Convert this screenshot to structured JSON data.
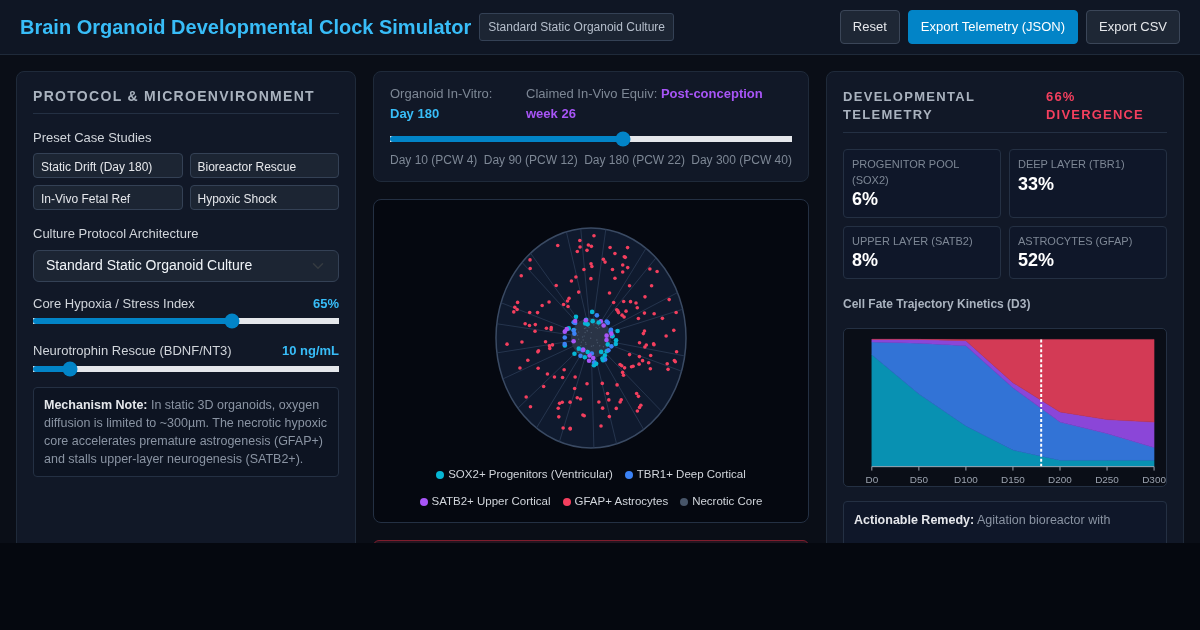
{
  "header": {
    "title": "Brain Organoid Developmental Clock Simulator",
    "badge": "Standard Static Organoid Culture",
    "buttons": [
      {
        "label": "Reset",
        "kind": "plain"
      },
      {
        "label": "Export Telemetry (JSON)",
        "kind": "primary"
      },
      {
        "label": "Export CSV",
        "kind": "plain"
      }
    ]
  },
  "protocol_panel": {
    "title": "PROTOCOL & MICROENVIRONMENT",
    "presets_label": "Preset Case Studies",
    "presets": [
      "Static Drift (Day 180)",
      "Bioreactor Rescue",
      "In-Vivo Fetal Ref",
      "Hypoxic Shock"
    ],
    "architecture_label": "Culture Protocol Architecture",
    "architecture": {
      "value": "Standard Static Organoid Culture"
    },
    "sliders": [
      {
        "label": "Core Hypoxia / Stress Index",
        "reading": "65%",
        "level": 0.65
      },
      {
        "label": "Neurotrophin Rescue (BDNF/NT3)",
        "reading": "10 ng/mL",
        "level": 0.12
      }
    ],
    "note": "**Mechanism Note:** In static 3D organoids, oxygen diffusion is limited to ~300µm. The necrotic hypoxic core accelerates premature astrogenesis (GFAP+) and stalls upper-layer neurogenesis (SATB2+)."
  },
  "timeline": {
    "invitro_label": "Organoid In-Vitro:",
    "invitro_value": "Day 180",
    "invivo_label": "Claimed In-Vivo Equiv:",
    "invivo_value": "Post-conception week 26",
    "level": 0.58,
    "ticks": [
      "Day 10 (PCW 4)",
      "Day 90 (PCW 12)",
      "Day 180 (PCW 22)",
      "Day 300 (PCW 40)"
    ]
  },
  "organoid": {
    "legend": [
      {
        "label": "SOX2+ Progenitors (Ventricular)",
        "color": "#06b6d4"
      },
      {
        "label": "TBR1+ Deep Cortical",
        "color": "#3b82f6"
      },
      {
        "label": "SATB2+ Upper Cortical",
        "color": "#a855f7"
      },
      {
        "label": "GFAP+ Astrocytes",
        "color": "#f43f5e"
      },
      {
        "label": "Necrotic Core",
        "color": "#475569"
      }
    ]
  },
  "alert": {
    "kind": "danger"
  },
  "telemetry": {
    "title": "DEVELOPMENTAL TELEMETRY",
    "divergence": "66% DIVERGENCE",
    "metrics": [
      {
        "label": "PROGENITOR POOL (SOX2)",
        "value": "6%"
      },
      {
        "label": "DEEP LAYER (TBR1)",
        "value": "33%"
      },
      {
        "label": "UPPER LAYER (SATB2)",
        "value": "8%"
      },
      {
        "label": "ASTROCYTES (GFAP)",
        "value": "52%"
      }
    ],
    "chart_title": "Cell Fate Trajectory Kinetics (D3)",
    "chart_axis_labels": [
      "D0",
      "D50",
      "D100",
      "D150",
      "D200",
      "D250",
      "D300"
    ],
    "remedy": "**Actionable Remedy:** Agitation bioreactor with"
  }
}
